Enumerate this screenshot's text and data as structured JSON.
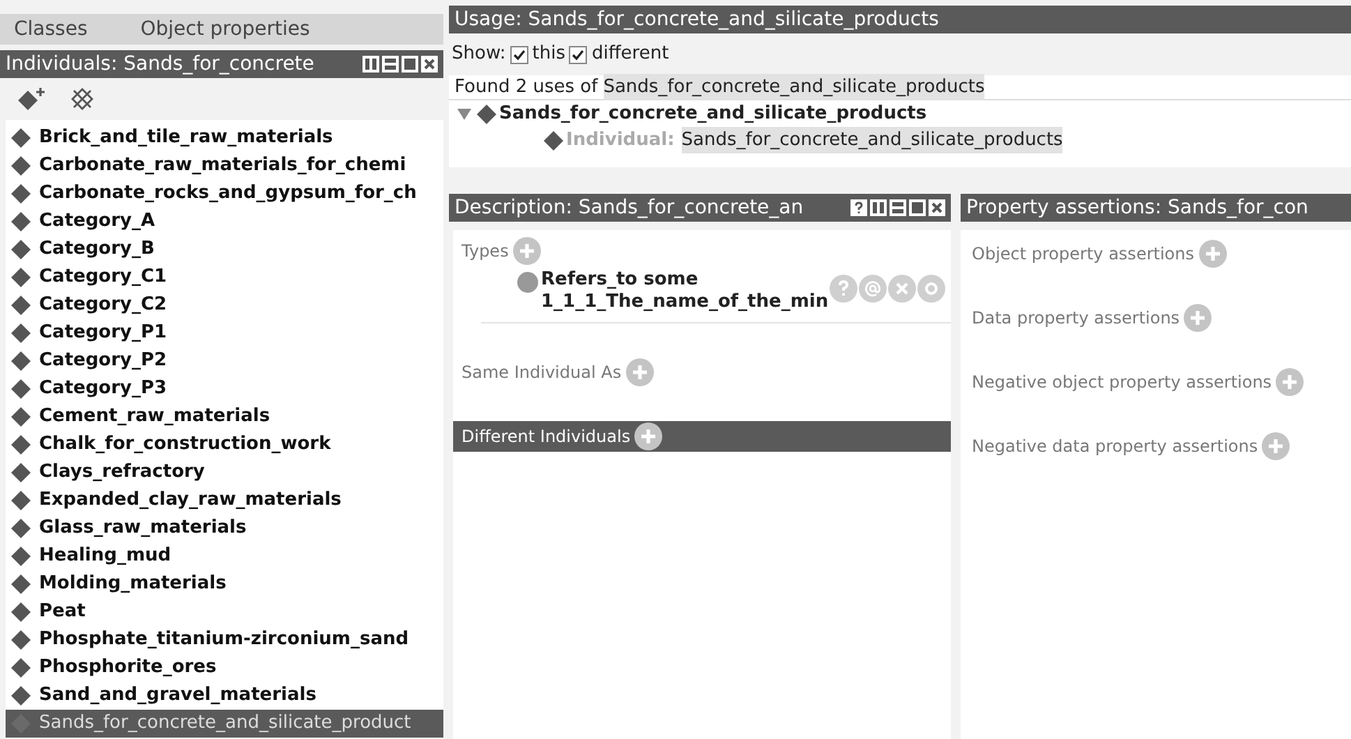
{
  "left_tabs": [
    {
      "label": "Classes"
    },
    {
      "label": "Object properties"
    }
  ],
  "individuals": {
    "title": "Individuals: Sands_for_concrete",
    "items": [
      {
        "label": "Brick_and_tile_raw_materials",
        "selected": false
      },
      {
        "label": "Carbonate_raw_materials_for_chemi",
        "selected": false
      },
      {
        "label": "Carbonate_rocks_and_gypsum_for_ch",
        "selected": false
      },
      {
        "label": "Category_A",
        "selected": false
      },
      {
        "label": "Category_B",
        "selected": false
      },
      {
        "label": "Category_C1",
        "selected": false
      },
      {
        "label": "Category_C2",
        "selected": false
      },
      {
        "label": "Category_P1",
        "selected": false
      },
      {
        "label": "Category_P2",
        "selected": false
      },
      {
        "label": "Category_P3",
        "selected": false
      },
      {
        "label": "Cement_raw_materials",
        "selected": false
      },
      {
        "label": "Chalk_for_construction_work",
        "selected": false
      },
      {
        "label": "Clays_refractory",
        "selected": false
      },
      {
        "label": "Expanded_clay_raw_materials",
        "selected": false
      },
      {
        "label": "Glass_raw_materials",
        "selected": false
      },
      {
        "label": "Healing_mud",
        "selected": false
      },
      {
        "label": "Molding_materials",
        "selected": false
      },
      {
        "label": "Peat",
        "selected": false
      },
      {
        "label": "Phosphate_titanium-zirconium_sand",
        "selected": false
      },
      {
        "label": "Phosphorite_ores",
        "selected": false
      },
      {
        "label": "Sand_and_gravel_materials",
        "selected": false
      },
      {
        "label": "Sands_for_concrete_and_silicate_product",
        "selected": true
      }
    ]
  },
  "usage": {
    "title": "Usage: Sands_for_concrete_and_silicate_products",
    "show_label": "Show:",
    "options": [
      {
        "label": "this",
        "checked": true
      },
      {
        "label": "different",
        "checked": true
      }
    ],
    "found_prefix": "Found 2 uses of",
    "found_name": "Sands_for_concrete_and_silicate_products",
    "tree": [
      {
        "label": "Sands_for_concrete_and_silicate_products",
        "expanded": true,
        "children": [
          {
            "prefix": "Individual:",
            "label": "Sands_for_concrete_and_silicate_products"
          }
        ]
      }
    ]
  },
  "description": {
    "title": "Description: Sands_for_concrete_an",
    "sections": [
      {
        "label": "Types",
        "selected": false,
        "items": [
          {
            "line_1": "Refers_to some",
            "line_2": "1_1_1_The_name_of_the_min"
          }
        ]
      },
      {
        "label": "Same Individual As",
        "selected": false
      },
      {
        "label": "Different Individuals",
        "selected": true
      }
    ]
  },
  "property_assertions": {
    "title": "Property assertions: Sands_for_con",
    "sections": [
      {
        "label": "Object property assertions"
      },
      {
        "label": "Data property assertions"
      },
      {
        "label": "Negative object property assertions"
      },
      {
        "label": "Negative data property assertions"
      }
    ]
  }
}
